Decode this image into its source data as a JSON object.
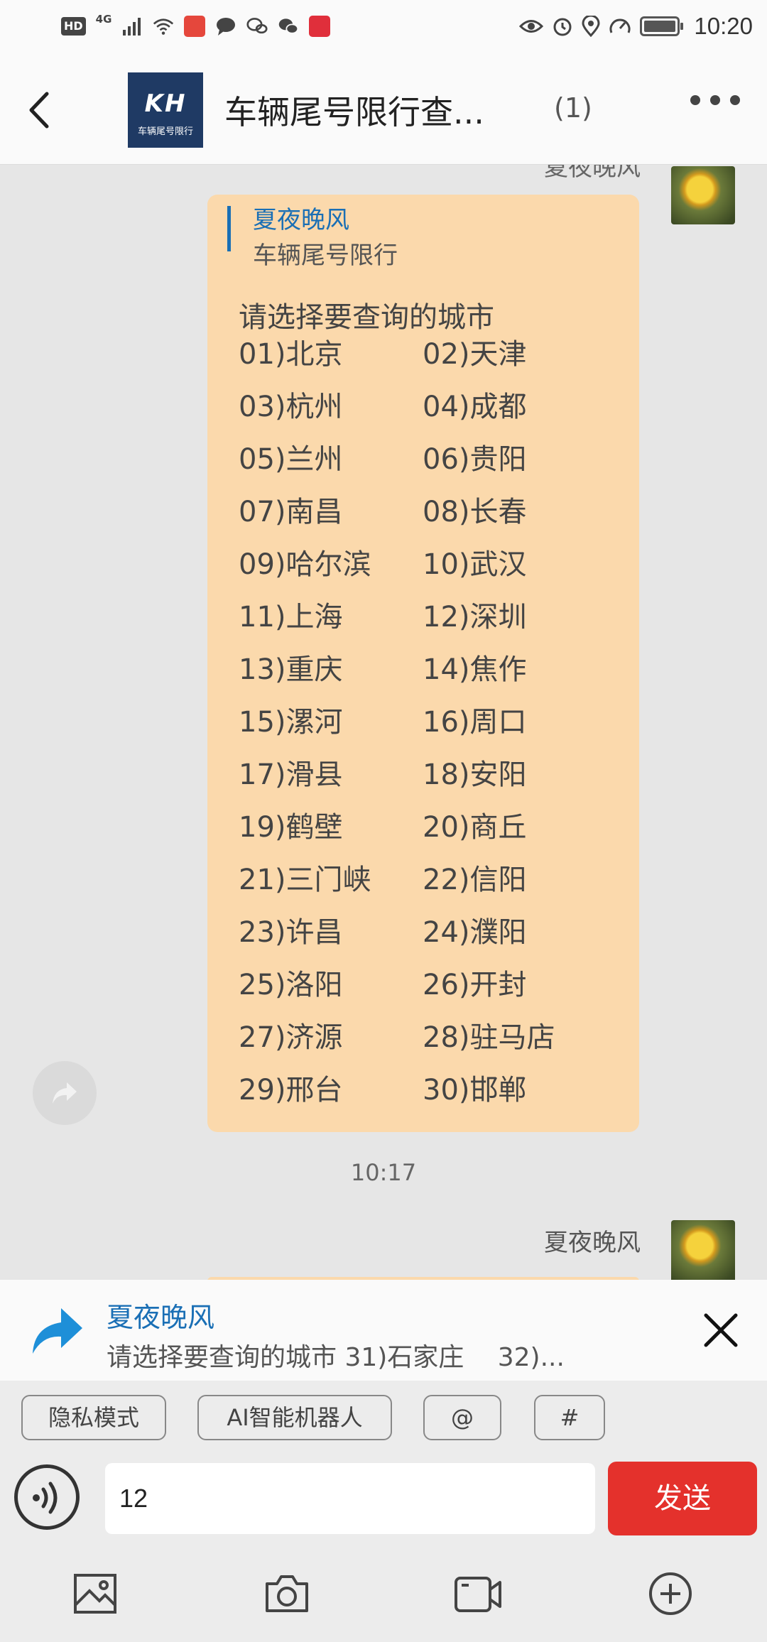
{
  "status_bar": {
    "hd": "HD",
    "network": "4G",
    "time": "10:20"
  },
  "header": {
    "title": "车辆尾号限行查...",
    "member_count": "(1)",
    "logo_mark": "KH",
    "logo_sub": "车辆尾号限行"
  },
  "chat": {
    "top_sender_cut": "夏夜晚风",
    "message": {
      "quote_name": "夏夜晚风",
      "quote_text": "车辆尾号限行",
      "heading": "请选择要查询的城市",
      "cities": [
        "01)北京",
        "02)天津",
        "03)杭州",
        "04)成都",
        "05)兰州",
        "06)贵阳",
        "07)南昌",
        "08)长春",
        "09)哈尔滨",
        "10)武汉",
        "11)上海",
        "12)深圳",
        "13)重庆",
        "14)焦作",
        "15)漯河",
        "16)周口",
        "17)滑县",
        "18)安阳",
        "19)鹤壁",
        "20)商丘",
        "21)三门峡",
        "22)信阳",
        "23)许昌",
        "24)濮阳",
        "25)洛阳",
        "26)开封",
        "27)济源",
        "28)驻马店",
        "29)邢台",
        "30)邯郸"
      ]
    },
    "timestamp": "10:17",
    "sender_name": "夏夜晚风"
  },
  "reply_preview": {
    "name": "夏夜晚风",
    "text": "请选择要查询的城市 31)石家庄 　32)..."
  },
  "chips": [
    "隐私模式",
    "AI智能机器人",
    "@",
    "#"
  ],
  "input": {
    "value": "12"
  },
  "send_label": "发送",
  "icons": {
    "back": "back-arrow-icon",
    "more": "more-dots-icon",
    "share": "share-icon",
    "reply": "reply-arrow-icon",
    "close": "close-icon",
    "voice": "voice-icon",
    "image": "image-icon",
    "camera": "camera-icon",
    "video": "video-icon",
    "plus": "plus-icon"
  },
  "colors": {
    "accent_blue": "#1a6fb5",
    "bubble": "#fbd9ac",
    "send_button": "#e4312c"
  }
}
